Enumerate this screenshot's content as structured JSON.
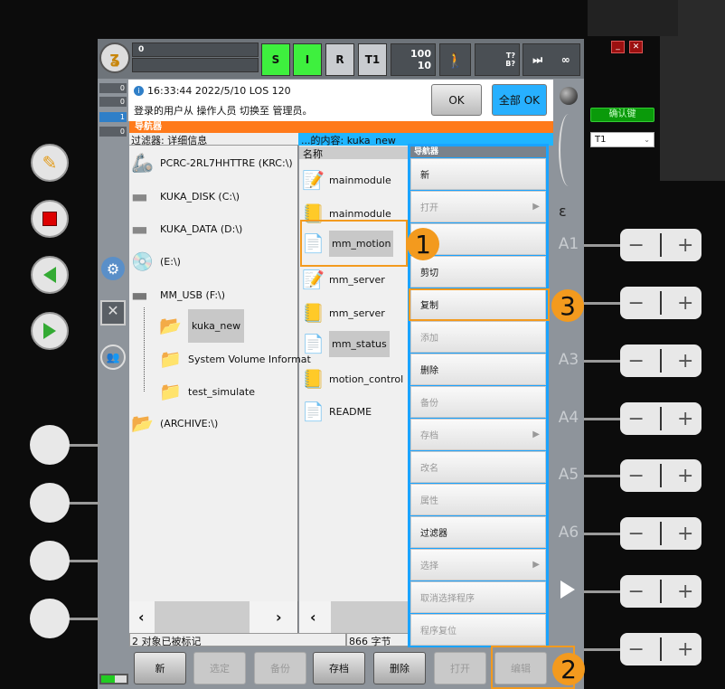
{
  "topbar": {
    "field_value": "0",
    "mode_s": "S",
    "mode_i": "I",
    "mode_r": "R",
    "mode_t1": "T1",
    "override_prog": "100",
    "override_jog": "10",
    "tool_t": "T?",
    "tool_b": "B?",
    "infinite": "∞"
  },
  "side_counts": [
    "0",
    "0",
    "1",
    "0"
  ],
  "message": {
    "time": "16:33:44 2022/5/10 LOS 120",
    "text": "登录的用户从 操作人员 切换至 管理员。",
    "ok": "OK",
    "all_ok": "全部 OK"
  },
  "navigator": {
    "title": "导航器",
    "filter": "过滤器: 详细信息",
    "contents": "...的内容: kuka_new",
    "name_header": "名称",
    "tree": [
      {
        "label": "PCRC-2RL7HHTTRE (KRC:\\)",
        "icon": "robot-icon"
      },
      {
        "label": "KUKA_DISK (C:\\)",
        "icon": "drive-icon"
      },
      {
        "label": "KUKA_DATA (D:\\)",
        "icon": "drive-icon"
      },
      {
        "label": "(E:\\)",
        "icon": "cd-drive-icon"
      },
      {
        "label": "MM_USB (F:\\)",
        "icon": "usb-drive-icon"
      },
      {
        "label": "kuka_new",
        "icon": "folder-open-icon",
        "selected": true
      },
      {
        "label": "System Volume Informat",
        "icon": "folder-icon"
      },
      {
        "label": "test_simulate",
        "icon": "folder-icon"
      },
      {
        "label": "(ARCHIVE:\\)",
        "icon": "archive-folder-icon"
      }
    ],
    "files": [
      {
        "label": "mainmodule",
        "icon": "src-file-icon"
      },
      {
        "label": "mainmodule",
        "icon": "dat-file-icon"
      },
      {
        "label": "mm_motion",
        "icon": "text-file-icon",
        "selected": true
      },
      {
        "label": "mm_server",
        "icon": "src-file-icon"
      },
      {
        "label": "mm_server",
        "icon": "dat-file-icon"
      },
      {
        "label": "mm_status",
        "icon": "text-file-icon",
        "selected": true
      },
      {
        "label": "motion_control",
        "icon": "dat-file-icon"
      },
      {
        "label": "README",
        "icon": "text-file-icon"
      }
    ],
    "status_marked": "2 对象已被标记",
    "status_size": "866 字节"
  },
  "menu": {
    "title": "导航器",
    "items": [
      {
        "label": "新",
        "enabled": true
      },
      {
        "label": "打开",
        "enabled": false,
        "sub": true
      },
      {
        "label": "",
        "enabled": true
      },
      {
        "label": "剪切",
        "enabled": true
      },
      {
        "label": "复制",
        "enabled": true
      },
      {
        "label": "添加",
        "enabled": false
      },
      {
        "label": "删除",
        "enabled": true
      },
      {
        "label": "备份",
        "enabled": false
      },
      {
        "label": "存档",
        "enabled": false,
        "sub": true
      },
      {
        "label": "改名",
        "enabled": false
      },
      {
        "label": "属性",
        "enabled": false
      },
      {
        "label": "过滤器",
        "enabled": true
      },
      {
        "label": "选择",
        "enabled": false,
        "sub": true
      },
      {
        "label": "取消选择程序",
        "enabled": false
      },
      {
        "label": "程序复位",
        "enabled": false
      }
    ]
  },
  "bottom_buttons": [
    {
      "label": "新",
      "enabled": true
    },
    {
      "label": "选定",
      "enabled": false
    },
    {
      "label": "备份",
      "enabled": false
    },
    {
      "label": "存档",
      "enabled": true
    },
    {
      "label": "删除",
      "enabled": true
    },
    {
      "label": "打开",
      "enabled": false
    },
    {
      "label": "编辑",
      "enabled": false
    }
  ],
  "axes": [
    "A1",
    "",
    "A3",
    "A4",
    "A5",
    "A6"
  ],
  "badges": [
    "1",
    "2",
    "3"
  ],
  "right_panel": {
    "confirm": "确认键",
    "mode_select": "T1"
  },
  "colors": {
    "accent_orange": "#ff7a1a",
    "menu_blue": "#1aa3ff",
    "mode_green": "#3ef03e",
    "callout": "#f39a1e"
  }
}
